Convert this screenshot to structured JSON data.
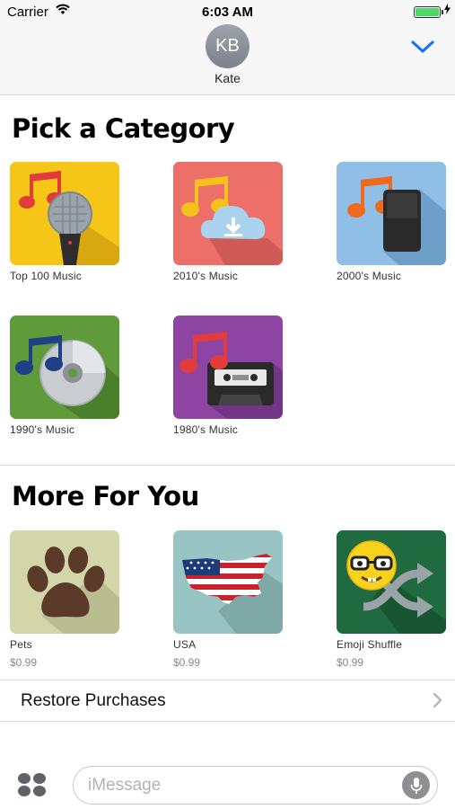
{
  "status_bar": {
    "carrier": "Carrier",
    "time": "6:03 AM"
  },
  "header": {
    "avatar_initials": "KB",
    "contact_name": "Kate"
  },
  "categories": {
    "title": "Pick a Category",
    "items": [
      {
        "label": "Top 100 Music",
        "icon": "microphone-music-icon"
      },
      {
        "label": "2010's Music",
        "icon": "cloud-download-music-icon"
      },
      {
        "label": "2000's Music",
        "icon": "mp3-player-music-icon"
      },
      {
        "label": "1990's Music",
        "icon": "cd-music-icon"
      },
      {
        "label": "1980's Music",
        "icon": "cassette-music-icon"
      }
    ]
  },
  "more": {
    "title": "More For You",
    "items": [
      {
        "label": "Pets",
        "price": "$0.99",
        "icon": "paw-print-icon"
      },
      {
        "label": "USA",
        "price": "$0.99",
        "icon": "usa-flag-map-icon"
      },
      {
        "label": "Emoji Shuffle",
        "price": "$0.99",
        "icon": "nerd-emoji-shuffle-icon"
      }
    ]
  },
  "restore": {
    "label": "Restore Purchases"
  },
  "compose": {
    "placeholder": "iMessage"
  },
  "colors": {
    "accent": "#1a73e8",
    "tile_top100": "#f5c518",
    "tile_2010s": "#ec6f6a",
    "tile_2000s": "#8fbfe6",
    "tile_1990s": "#5f9b3a",
    "tile_1980s": "#8e44a3",
    "tile_pets": "#d2d6a8",
    "tile_usa": "#98c5c3",
    "tile_emoji": "#1f6b3f"
  }
}
